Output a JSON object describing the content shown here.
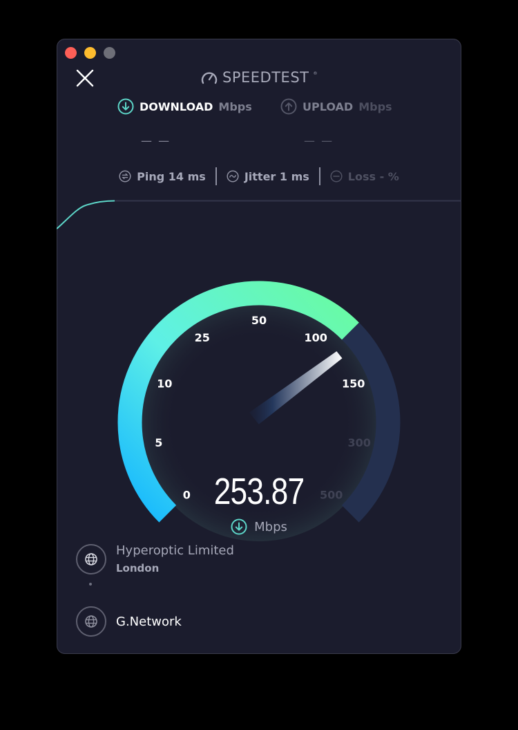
{
  "window": {
    "traffic_lights": [
      {
        "name": "close",
        "color": "#fe5f57"
      },
      {
        "name": "minimize",
        "color": "#febc2e"
      },
      {
        "name": "zoom",
        "color": "#6e6f78"
      }
    ]
  },
  "header": {
    "brand": "SPEEDTEST",
    "trademark": "®"
  },
  "download": {
    "label": "DOWNLOAD",
    "unit": "Mbps",
    "value": "— —",
    "active": true
  },
  "upload": {
    "label": "UPLOAD",
    "unit": "Mbps",
    "value": "— —",
    "active": false
  },
  "stats": {
    "ping": "Ping 14 ms",
    "jitter": "Jitter 1 ms",
    "loss": "Loss - %"
  },
  "gauge": {
    "ticks": [
      "0",
      "5",
      "10",
      "25",
      "50",
      "100",
      "150",
      "300",
      "500"
    ],
    "tick_values": [
      0,
      5,
      10,
      25,
      50,
      100,
      150,
      300,
      500
    ],
    "current_value": 253.87
  },
  "speed": {
    "value": "253.87",
    "unit": "Mbps"
  },
  "servers": [
    {
      "title": "Hyperoptic Limited",
      "subtitle": "London"
    },
    {
      "title": "G.Network"
    }
  ],
  "colors": {
    "background": "#1b1c2d",
    "accent_cyan": "#1ab8f5",
    "accent_green": "#6afba0",
    "track": "#24304f",
    "icon_teal": "#5dd6c8"
  }
}
